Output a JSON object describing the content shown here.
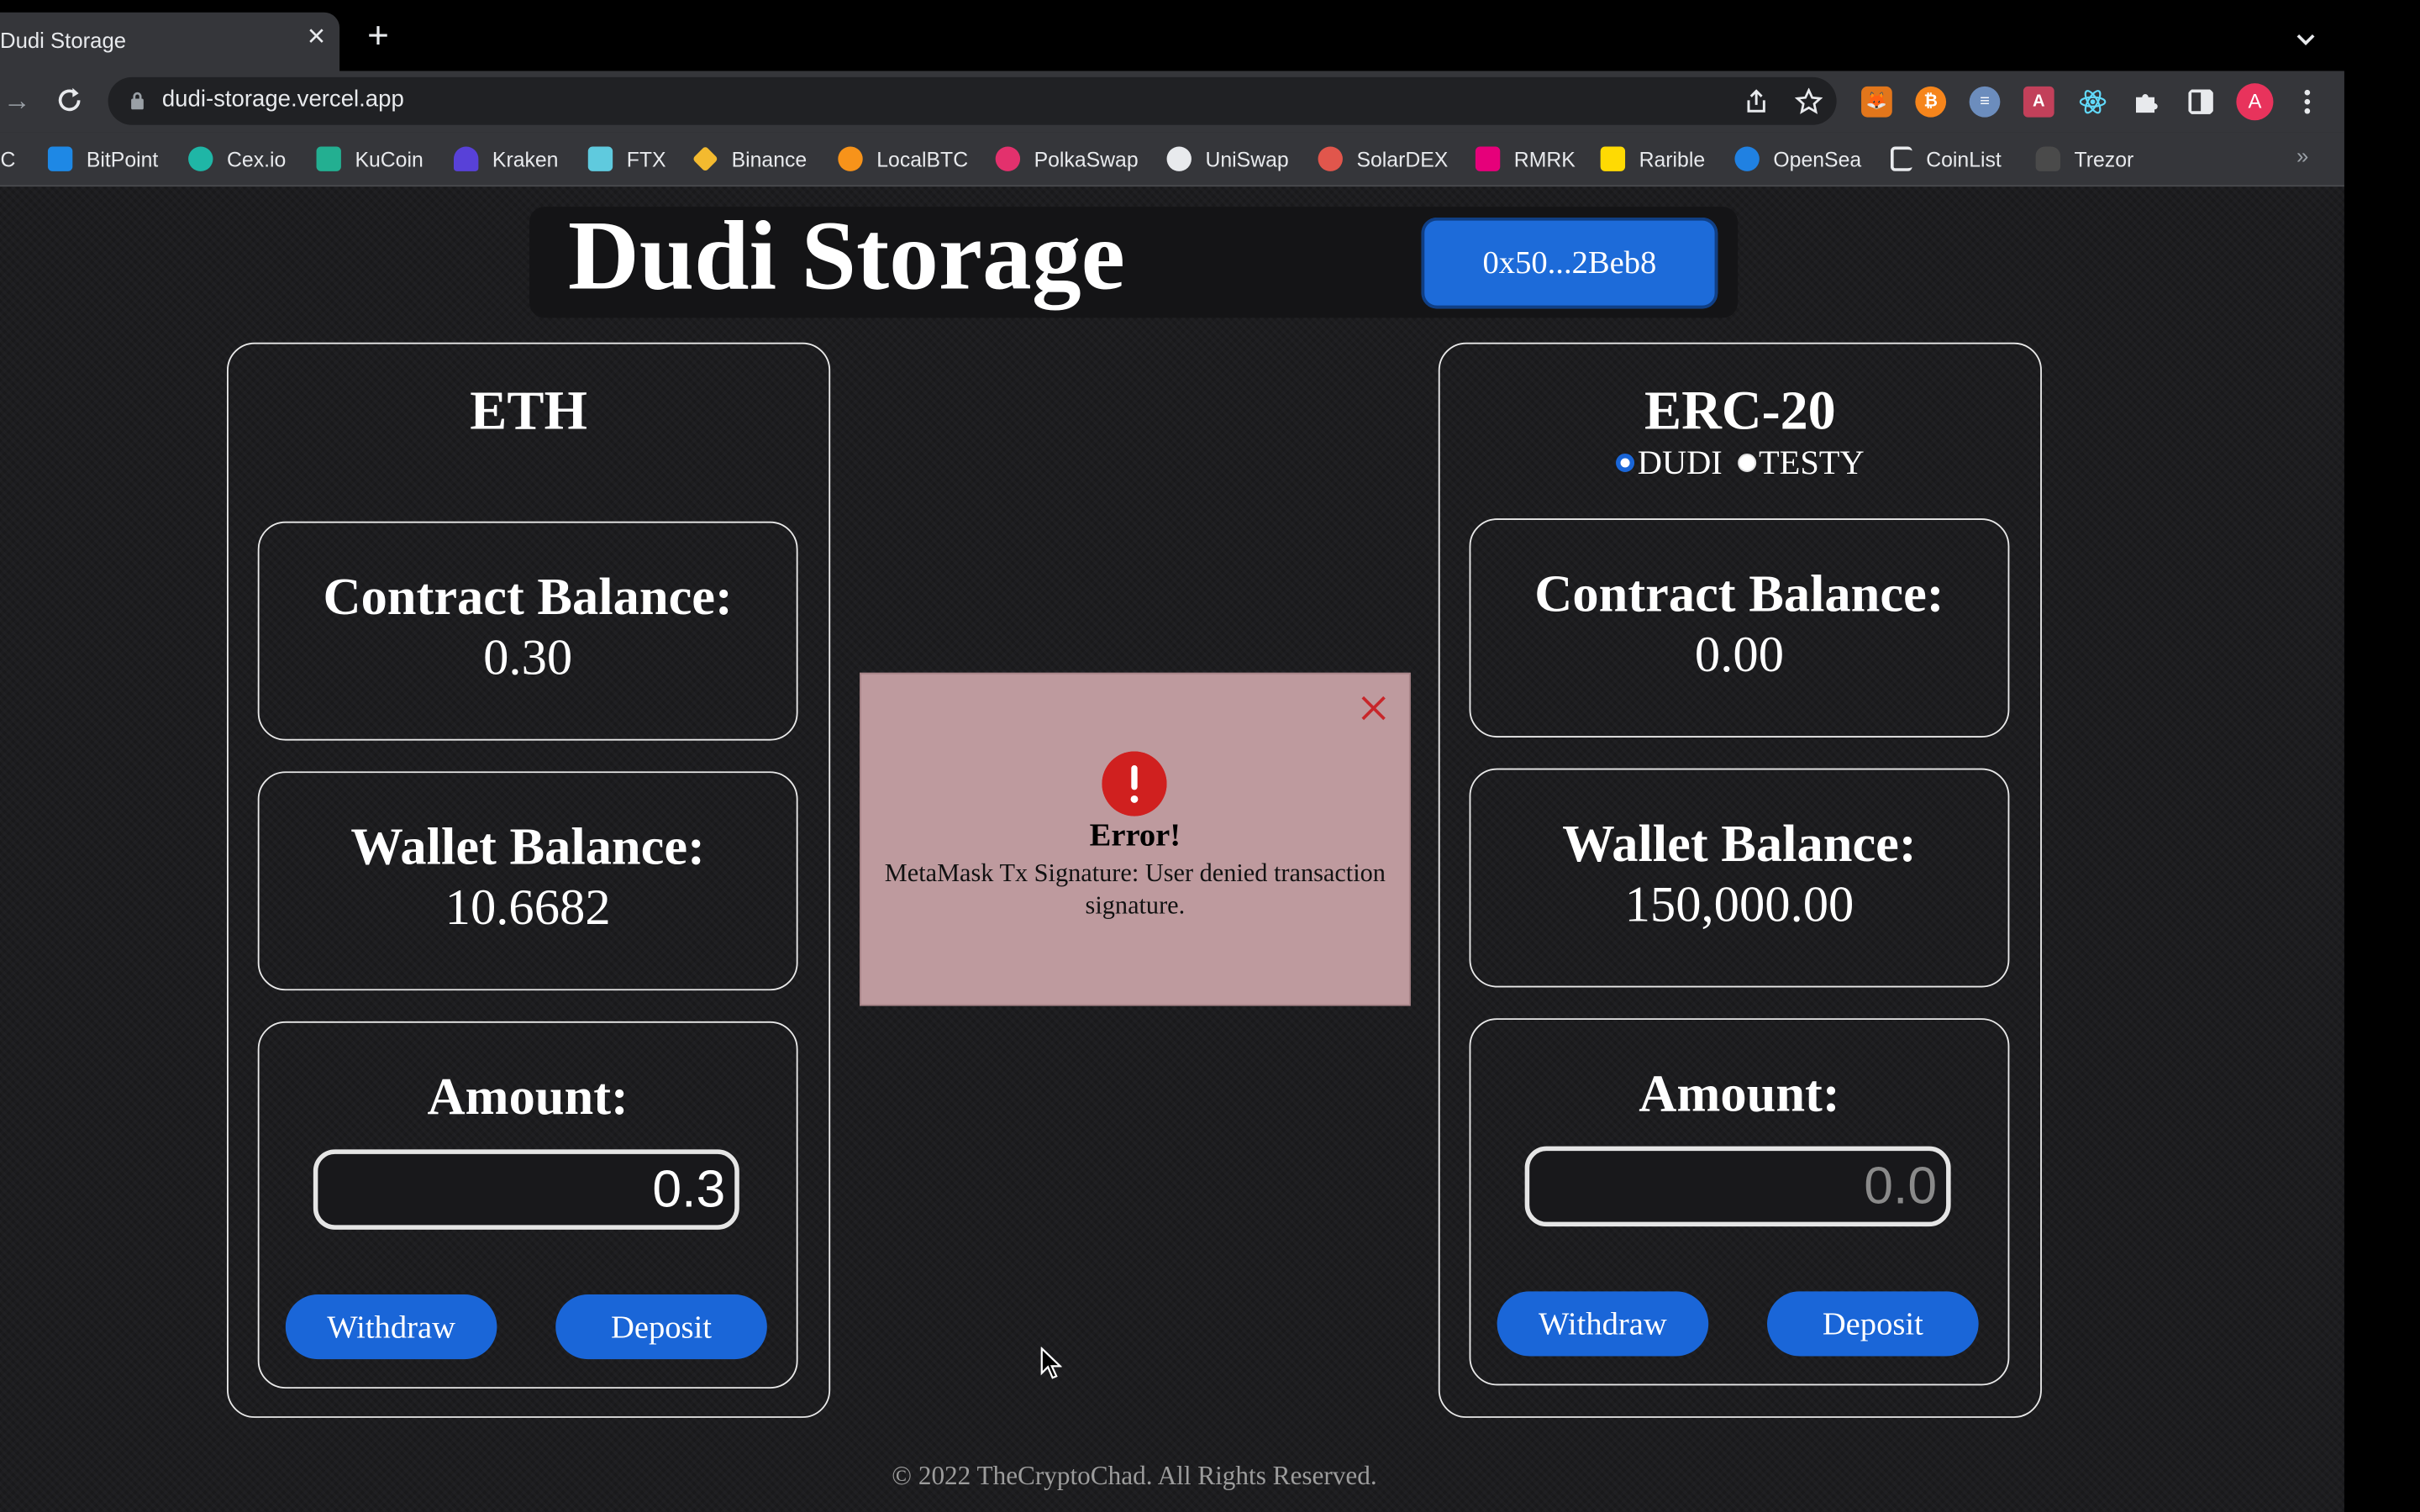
{
  "browser": {
    "tab_title": "Dudi Storage",
    "tab_close": "×",
    "new_tab": "+",
    "url": "dudi-storage.vercel.app",
    "avatar_letter": "A",
    "bookmarks_more": "»",
    "bookmarks": [
      {
        "label": "TC",
        "color": "#f7931a"
      },
      {
        "label": "BitPoint",
        "color": "#1e88e5"
      },
      {
        "label": "Cex.io",
        "color": "#1fb6a6"
      },
      {
        "label": "KuCoin",
        "color": "#23af91"
      },
      {
        "label": "Kraken",
        "color": "#5841d8"
      },
      {
        "label": "FTX",
        "color": "#5fcade"
      },
      {
        "label": "Binance",
        "color": "#f3ba2f"
      },
      {
        "label": "LocalBTC",
        "color": "#f7931a"
      },
      {
        "label": "PolkaSwap",
        "color": "#e3316d"
      },
      {
        "label": "UniSwap",
        "color": "#e8eaed"
      },
      {
        "label": "SolarDEX",
        "color": "#e1564c"
      },
      {
        "label": "RMRK",
        "color": "#e6007a"
      },
      {
        "label": "Rarible",
        "color": "#feda03"
      },
      {
        "label": "OpenSea",
        "color": "#2081e2"
      },
      {
        "label": "CoinList",
        "color": "#e8eaed"
      },
      {
        "label": "Trezor",
        "color": "#666666"
      }
    ]
  },
  "app": {
    "title": "Dudi Storage",
    "wallet_address": "0x50...2Beb8",
    "eth_panel": {
      "title": "ETH",
      "contract_balance_label": "Contract Balance:",
      "contract_balance_value": "0.30",
      "wallet_balance_label": "Wallet Balance:",
      "wallet_balance_value": "10.6682",
      "amount_label": "Amount:",
      "amount_value": "0.3",
      "withdraw_label": "Withdraw",
      "deposit_label": "Deposit"
    },
    "erc20_panel": {
      "title": "ERC-20",
      "token_options": [
        "DUDI",
        "TESTY"
      ],
      "selected_token": "DUDI",
      "contract_balance_label": "Contract Balance:",
      "contract_balance_value": "0.00",
      "wallet_balance_label": "Wallet Balance:",
      "wallet_balance_value": "150,000.00",
      "amount_label": "Amount:",
      "amount_placeholder": "0.0",
      "withdraw_label": "Withdraw",
      "deposit_label": "Deposit"
    },
    "alert": {
      "title": "Error!",
      "message": "MetaMask Tx Signature: User denied transaction signature."
    },
    "footer": "© 2022 TheCryptoChad. All Rights Reserved."
  },
  "colors": {
    "accent": "#1a66d8",
    "error_bg": "#be9a9e",
    "error_icon": "#d0201f"
  }
}
